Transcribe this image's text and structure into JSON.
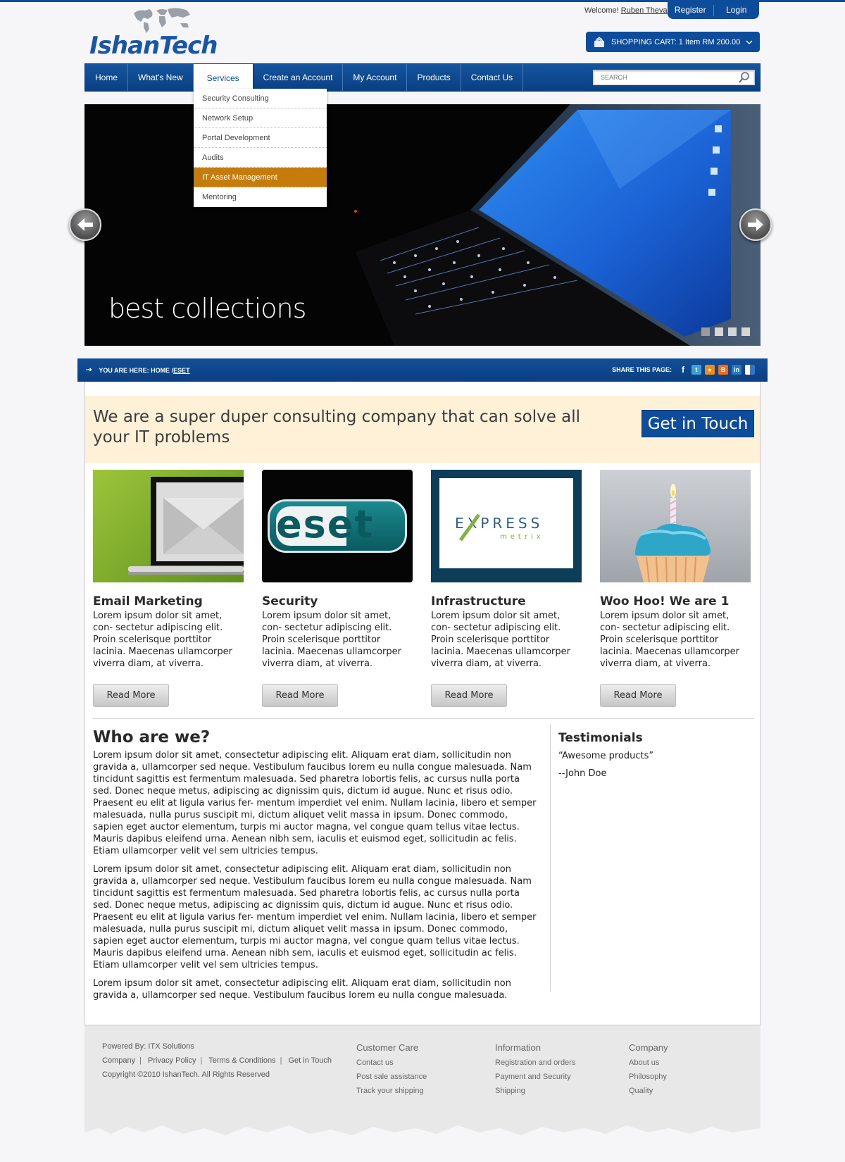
{
  "header": {
    "logo_text": "IshanTech",
    "welcome_prefix": "Welcome!",
    "user_name": "Ruben Theva",
    "register_label": "Register",
    "login_label": "Login",
    "cart_text": "SHOPPING CART: 1 Item  RM 200.00"
  },
  "nav": {
    "items": [
      "Home",
      "What's New",
      "Services",
      "Create an Account",
      "My Account",
      "Products",
      "Contact Us"
    ],
    "active_index": 2,
    "search_placeholder": "SEARCH"
  },
  "services_menu": {
    "items": [
      "Security Consulting",
      "Network Setup",
      "Portal Development",
      "Audits",
      "IT Asset Management",
      "Mentoring"
    ],
    "highlighted_index": 4
  },
  "hero": {
    "caption": "best collections",
    "slide_count": 4,
    "current_slide": 1
  },
  "breadcrumb": {
    "label": "YOU ARE HERE: HOME / ",
    "current": "ESET",
    "share_label": "SHARE THIS PAGE:",
    "share_icons": [
      "facebook-icon",
      "twitter-icon",
      "rss-icon",
      "blogger-icon",
      "linkedin-icon",
      "delicious-icon"
    ]
  },
  "promo": {
    "text": "We are a super duper consulting company that can solve all your IT problems",
    "button_label": "Get in Touch"
  },
  "cards": [
    {
      "title": "Email Marketing",
      "body": "Lorem ipsum dolor sit amet, con- sectetur adipiscing elit. Proin scelerisque porttitor lacinia. Maecenas ullamcorper viverra diam, at viverra.",
      "button": "Read More"
    },
    {
      "title": "Security",
      "body": "Lorem ipsum dolor sit amet, con- sectetur adipiscing elit. Proin scelerisque porttitor lacinia. Maecenas ullamcorper viverra diam, at viverra.",
      "button": "Read More",
      "logo_text": "eset"
    },
    {
      "title": "Infrastructure",
      "body": "Lorem ipsum dolor sit amet, con- sectetur adipiscing elit. Proin scelerisque porttitor lacinia. Maecenas ullamcorper viverra diam, at viverra.",
      "button": "Read More",
      "logo_text": "EXPRESS",
      "logo_sub": "metrix"
    },
    {
      "title": "Woo Hoo! We are 1",
      "body": "Lorem ipsum dolor sit amet, con- sectetur adipiscing elit. Proin scelerisque porttitor lacinia. Maecenas ullamcorper viverra diam, at viverra.",
      "button": "Read More"
    }
  ],
  "about": {
    "title": "Who are we?",
    "paragraphs": [
      "Lorem ipsum dolor sit amet, consectetur adipiscing elit. Aliquam erat diam, sollicitudin non gravida a, ullamcorper sed neque. Vestibulum faucibus lorem eu nulla congue malesuada. Nam tincidunt sagittis est fermentum malesuada. Sed pharetra lobortis felis, ac cursus nulla porta sed. Donec neque metus, adipiscing ac dignissim quis, dictum id augue. Nunc et risus odio. Praesent eu elit at ligula varius fer- mentum imperdiet vel enim. Nullam lacinia, libero et semper malesuada, nulla purus suscipit mi, dictum aliquet velit massa in ipsum. Donec commodo, sapien eget auctor elementum, turpis mi auctor magna, vel congue quam tellus vitae lectus. Mauris dapibus eleifend urna. Aenean nibh sem, iaculis et euismod eget, sollicitudin ac felis. Etiam ullamcorper velit vel sem ultricies tempus.",
      "Lorem ipsum dolor sit amet, consectetur adipiscing elit. Aliquam erat diam, sollicitudin non gravida a, ullamcorper sed neque. Vestibulum faucibus lorem eu nulla congue malesuada. Nam tincidunt sagittis est fermentum malesuada. Sed pharetra lobortis felis, ac cursus nulla porta sed. Donec neque metus, adipiscing ac dignissim quis, dictum id augue. Nunc et risus odio. Praesent eu elit at ligula varius fer- mentum imperdiet vel enim. Nullam lacinia, libero et semper malesuada, nulla purus suscipit mi, dictum aliquet velit massa in ipsum. Donec commodo, sapien eget auctor elementum, turpis mi auctor magna, vel congue quam tellus vitae lectus. Mauris dapibus eleifend urna. Aenean nibh sem, iaculis et euismod eget, sollicitudin ac felis. Etiam ullamcorper velit vel sem ultricies tempus.",
      "Lorem ipsum dolor sit amet, consectetur adipiscing elit. Aliquam erat diam, sollicitudin non gravida a, ullamcorper sed neque. Vestibulum faucibus lorem eu nulla congue malesuada."
    ]
  },
  "testimonials": {
    "title": "Testimonials",
    "quote": "“Awesome products”",
    "author": "--John Doe"
  },
  "footer": {
    "powered_by": "Powered By: ITX Solutions",
    "links": [
      "Company",
      "Privacy Policy",
      "Terms & Conditions",
      "Get in Touch"
    ],
    "copyright": "Copyright ©2010 IshanTech. All Rights Reserved",
    "columns": [
      {
        "title": "Customer Care",
        "items": [
          "Contact us",
          "Post sale assistance",
          "Track your shipping"
        ]
      },
      {
        "title": "Information",
        "items": [
          "Registration and orders",
          "Payment and Security",
          "Shipping"
        ]
      },
      {
        "title": "Company",
        "items": [
          "About us",
          "Philosophy",
          "Quality"
        ]
      }
    ]
  },
  "colors": {
    "brand_blue": "#0d4c9a",
    "menu_highlight": "#c67c0c",
    "promo_bg": "#fff1d8"
  }
}
